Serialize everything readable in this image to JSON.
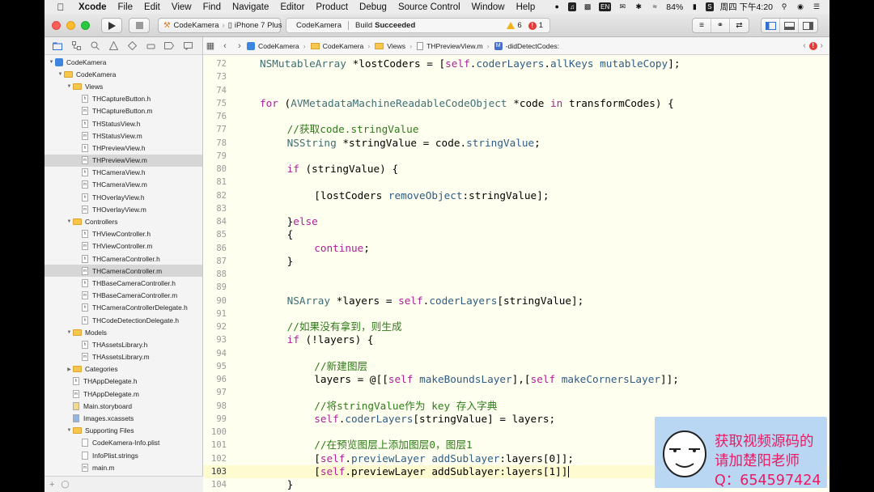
{
  "menubar": {
    "app": "Xcode",
    "items": [
      "File",
      "Edit",
      "View",
      "Find",
      "Navigate",
      "Editor",
      "Product",
      "Debug",
      "Source Control",
      "Window",
      "Help"
    ],
    "battery": "84%",
    "clock": "周四 下午4:20",
    "input_box": "EN"
  },
  "toolbar": {
    "scheme_project": "CodeKamera",
    "scheme_device": "iPhone 7 Plus",
    "activity_project": "CodeKamera",
    "activity_prefix": "Build",
    "activity_status": "Succeeded",
    "warning_count": "6",
    "error_count": "1"
  },
  "navigator": {
    "rows": [
      {
        "label": "CodeKamera",
        "kind": "project",
        "level": 0,
        "open": true
      },
      {
        "label": "CodeKamera",
        "kind": "folder",
        "level": 1,
        "open": true
      },
      {
        "label": "Views",
        "kind": "folder",
        "level": 2,
        "open": true
      },
      {
        "label": "THCaptureButton.h",
        "kind": "h",
        "level": 3
      },
      {
        "label": "THCaptureButton.m",
        "kind": "m",
        "level": 3
      },
      {
        "label": "THStatusView.h",
        "kind": "h",
        "level": 3
      },
      {
        "label": "THStatusView.m",
        "kind": "m",
        "level": 3
      },
      {
        "label": "THPreviewView.h",
        "kind": "h",
        "level": 3
      },
      {
        "label": "THPreviewView.m",
        "kind": "m",
        "level": 3,
        "selected": true
      },
      {
        "label": "THCameraView.h",
        "kind": "h",
        "level": 3
      },
      {
        "label": "THCameraView.m",
        "kind": "m",
        "level": 3
      },
      {
        "label": "THOverlayView.h",
        "kind": "h",
        "level": 3
      },
      {
        "label": "THOverlayView.m",
        "kind": "m",
        "level": 3
      },
      {
        "label": "Controllers",
        "kind": "folder",
        "level": 2,
        "open": true
      },
      {
        "label": "THViewController.h",
        "kind": "h",
        "level": 3
      },
      {
        "label": "THViewController.m",
        "kind": "m",
        "level": 3
      },
      {
        "label": "THCameraController.h",
        "kind": "h",
        "level": 3
      },
      {
        "label": "THCameraController.m",
        "kind": "m",
        "level": 3,
        "selected": true
      },
      {
        "label": "THBaseCameraController.h",
        "kind": "h",
        "level": 3
      },
      {
        "label": "THBaseCameraController.m",
        "kind": "m",
        "level": 3
      },
      {
        "label": "THCameraControllerDelegate.h",
        "kind": "h",
        "level": 3
      },
      {
        "label": "THCodeDetectionDelegate.h",
        "kind": "h",
        "level": 3
      },
      {
        "label": "Models",
        "kind": "folder",
        "level": 2,
        "open": true
      },
      {
        "label": "THAssetsLibrary.h",
        "kind": "h",
        "level": 3
      },
      {
        "label": "THAssetsLibrary.m",
        "kind": "m",
        "level": 3
      },
      {
        "label": "Categories",
        "kind": "folder",
        "level": 2,
        "open": false
      },
      {
        "label": "THAppDelegate.h",
        "kind": "h",
        "level": 2
      },
      {
        "label": "THAppDelegate.m",
        "kind": "m",
        "level": 2
      },
      {
        "label": "Main.storyboard",
        "kind": "storyboard",
        "level": 2
      },
      {
        "label": "Images.xcassets",
        "kind": "assets",
        "level": 2
      },
      {
        "label": "Supporting Files",
        "kind": "folder",
        "level": 2,
        "open": true
      },
      {
        "label": "CodeKamera-Info.plist",
        "kind": "plist",
        "level": 3
      },
      {
        "label": "InfoPlist.strings",
        "kind": "strings",
        "level": 3
      },
      {
        "label": "main.m",
        "kind": "m",
        "level": 3
      }
    ]
  },
  "jumpbar": {
    "crumbs": [
      "CodeKamera",
      "CodeKamera",
      "Views",
      "THPreviewView.m",
      "-didDetectCodes:"
    ]
  },
  "editor": {
    "lines": [
      {
        "n": "72",
        "i": 1,
        "t": [
          [
            "ty",
            "NSMutableArray"
          ],
          [
            "",
            " *lostCoders = ["
          ],
          [
            "kw",
            "self"
          ],
          [
            "",
            "."
          ],
          [
            "me",
            "coderLayers"
          ],
          [
            "",
            "."
          ],
          [
            "me",
            "allKeys"
          ],
          [
            "",
            " "
          ],
          [
            "me",
            "mutableCopy"
          ],
          [
            "",
            "];"
          ]
        ]
      },
      {
        "n": "73",
        "i": 0,
        "t": []
      },
      {
        "n": "74",
        "i": 0,
        "t": []
      },
      {
        "n": "75",
        "i": 1,
        "t": [
          [
            "kw",
            "for"
          ],
          [
            "",
            " ("
          ],
          [
            "ty",
            "AVMetadataMachineReadableCodeObject"
          ],
          [
            "",
            " *code "
          ],
          [
            "kw",
            "in"
          ],
          [
            "",
            " transformCodes) {"
          ]
        ]
      },
      {
        "n": "76",
        "i": 0,
        "t": []
      },
      {
        "n": "77",
        "i": 2,
        "t": [
          [
            "cm",
            "//获取code.stringValue"
          ]
        ]
      },
      {
        "n": "78",
        "i": 2,
        "t": [
          [
            "ty",
            "NSString"
          ],
          [
            "",
            " *stringValue = code."
          ],
          [
            "me",
            "stringValue"
          ],
          [
            "",
            ";"
          ]
        ]
      },
      {
        "n": "79",
        "i": 0,
        "t": []
      },
      {
        "n": "80",
        "i": 2,
        "t": [
          [
            "kw",
            "if"
          ],
          [
            "",
            " (stringValue) {"
          ]
        ]
      },
      {
        "n": "81",
        "i": 0,
        "t": []
      },
      {
        "n": "82",
        "i": 3,
        "t": [
          [
            "",
            "[lostCoders "
          ],
          [
            "me",
            "removeObject"
          ],
          [
            "",
            ":stringValue];"
          ]
        ]
      },
      {
        "n": "83",
        "i": 0,
        "t": []
      },
      {
        "n": "84",
        "i": 2,
        "t": [
          [
            "",
            "}"
          ],
          [
            "kw",
            "else"
          ]
        ]
      },
      {
        "n": "85",
        "i": 2,
        "t": [
          [
            "",
            "{"
          ]
        ]
      },
      {
        "n": "86",
        "i": 3,
        "t": [
          [
            "kw",
            "continue"
          ],
          [
            "",
            ";"
          ]
        ]
      },
      {
        "n": "87",
        "i": 2,
        "t": [
          [
            "",
            "}"
          ]
        ]
      },
      {
        "n": "88",
        "i": 0,
        "t": []
      },
      {
        "n": "89",
        "i": 0,
        "t": []
      },
      {
        "n": "90",
        "i": 2,
        "t": [
          [
            "ty",
            "NSArray"
          ],
          [
            "",
            " *layers = "
          ],
          [
            "kw",
            "self"
          ],
          [
            "",
            "."
          ],
          [
            "me",
            "coderLayers"
          ],
          [
            "",
            "[stringValue];"
          ]
        ]
      },
      {
        "n": "91",
        "i": 0,
        "t": []
      },
      {
        "n": "92",
        "i": 2,
        "t": [
          [
            "cm",
            "//如果没有拿到，则生成"
          ]
        ]
      },
      {
        "n": "93",
        "i": 2,
        "t": [
          [
            "kw",
            "if"
          ],
          [
            "",
            " (!layers) {"
          ]
        ]
      },
      {
        "n": "94",
        "i": 0,
        "t": []
      },
      {
        "n": "95",
        "i": 3,
        "t": [
          [
            "cm",
            "//新建图层"
          ]
        ]
      },
      {
        "n": "96",
        "i": 3,
        "t": [
          [
            "",
            "layers = @[["
          ],
          [
            "kw",
            "self"
          ],
          [
            "",
            " "
          ],
          [
            "me",
            "makeBoundsLayer"
          ],
          [
            "",
            "],["
          ],
          [
            "kw",
            "self"
          ],
          [
            "",
            " "
          ],
          [
            "me",
            "makeCornersLayer"
          ],
          [
            "",
            "]];"
          ]
        ]
      },
      {
        "n": "97",
        "i": 0,
        "t": []
      },
      {
        "n": "98",
        "i": 3,
        "t": [
          [
            "cm",
            "//将stringValue作为 key 存入字典"
          ]
        ]
      },
      {
        "n": "99",
        "i": 3,
        "t": [
          [
            "kw",
            "self"
          ],
          [
            "",
            "."
          ],
          [
            "me",
            "coderLayers"
          ],
          [
            "",
            "[stringValue] = layers;"
          ]
        ]
      },
      {
        "n": "100",
        "i": 0,
        "t": []
      },
      {
        "n": "101",
        "i": 3,
        "t": [
          [
            "cm",
            "//在预览图层上添加图层0，图层1"
          ]
        ]
      },
      {
        "n": "102",
        "i": 3,
        "t": [
          [
            "",
            "["
          ],
          [
            "kw",
            "self"
          ],
          [
            "",
            "."
          ],
          [
            "me",
            "previewLayer"
          ],
          [
            "",
            " "
          ],
          [
            "me",
            "addSublayer"
          ],
          [
            "",
            ":layers[0]];"
          ]
        ]
      },
      {
        "n": "103",
        "i": 3,
        "t": [
          [
            "",
            "["
          ],
          [
            "kw",
            "self"
          ],
          [
            "",
            ".previewLayer addSublayer:layers[1]]"
          ]
        ],
        "current": true
      },
      {
        "n": "104",
        "i": 2,
        "t": [
          [
            "",
            "}"
          ]
        ]
      }
    ]
  },
  "overlay": {
    "line1": "获取视频源码的",
    "line2": "请加楚阳老师",
    "line3": "Q：654597424"
  }
}
